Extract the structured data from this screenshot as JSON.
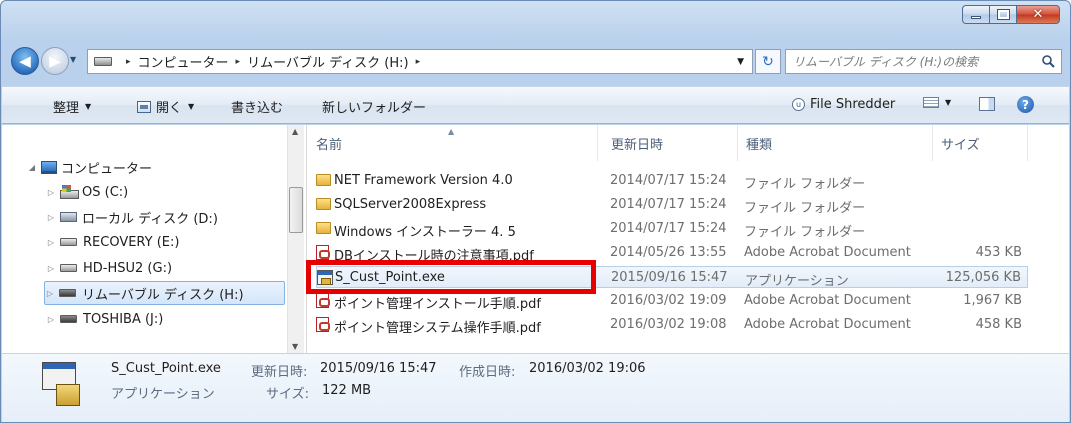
{
  "window": {
    "controls": {
      "minimize": "minimize-button",
      "maximize": "maximize-button",
      "close": "✕"
    }
  },
  "address_bar": {
    "separator": "▸",
    "breadcrumbs": [
      "コンピューター",
      "リムーバブル ディスク (H:)"
    ]
  },
  "search": {
    "placeholder": "リムーバブル ディスク (H:)の検索"
  },
  "toolbar": {
    "organize": "整理",
    "open": "開く",
    "burn": "書き込む",
    "new_folder": "新しいフォルダー",
    "file_shredder": "File Shredder"
  },
  "nav_tree": [
    {
      "label": "コンピューター",
      "icon": "computer-icon"
    },
    {
      "label": "OS (C:)",
      "icon": "os-drive-icon"
    },
    {
      "label": "ローカル ディスク (D:)",
      "icon": "local-disk-icon"
    },
    {
      "label": "RECOVERY (E:)",
      "icon": "drive-icon"
    },
    {
      "label": "HD-HSU2 (G:)",
      "icon": "drive-icon"
    },
    {
      "label": "リムーバブル ディスク (H:)",
      "icon": "removable-drive-icon",
      "selected": true
    },
    {
      "label": "TOSHIBA (J:)",
      "icon": "removable-drive-icon"
    }
  ],
  "columns": {
    "name": "名前",
    "modified": "更新日時",
    "type": "種類",
    "size": "サイズ"
  },
  "files": [
    {
      "name": "NET Framework Version 4.0",
      "modified": "2014/07/17 15:24",
      "type": "ファイル フォルダー",
      "size": "",
      "icon": "folder-icon"
    },
    {
      "name": "SQLServer2008Express",
      "modified": "2014/07/17 15:24",
      "type": "ファイル フォルダー",
      "size": "",
      "icon": "folder-icon"
    },
    {
      "name": "Windows インストーラー 4. 5",
      "modified": "2014/07/17 15:24",
      "type": "ファイル フォルダー",
      "size": "",
      "icon": "folder-icon"
    },
    {
      "name": "DBインストール時の注意事項.pdf",
      "modified": "2014/05/26 13:55",
      "type": "Adobe Acrobat Document",
      "size": "453 KB",
      "icon": "pdf-icon"
    },
    {
      "name": "S_Cust_Point.exe",
      "modified": "2015/09/16 15:47",
      "type": "アプリケーション",
      "size": "125,056 KB",
      "icon": "exe-icon",
      "selected": true
    },
    {
      "name": "ポイント管理インストール手順.pdf",
      "modified": "2016/03/02 19:09",
      "type": "Adobe Acrobat Document",
      "size": "1,967 KB",
      "icon": "pdf-icon"
    },
    {
      "name": "ポイント管理システム操作手順.pdf",
      "modified": "2016/03/02 19:08",
      "type": "Adobe Acrobat Document",
      "size": "458 KB",
      "icon": "pdf-icon"
    }
  ],
  "details": {
    "filename": "S_Cust_Point.exe",
    "modified_label": "更新日時:",
    "modified_value": "2015/09/16 15:47",
    "created_label": "作成日時:",
    "created_value": "2016/03/02 19:06",
    "type": "アプリケーション",
    "size_label": "サイズ:",
    "size_value": "122 MB"
  },
  "colors": {
    "highlight_border": "#e60000",
    "selection": "#d4e6fa",
    "chrome": "#bcd3ee"
  }
}
